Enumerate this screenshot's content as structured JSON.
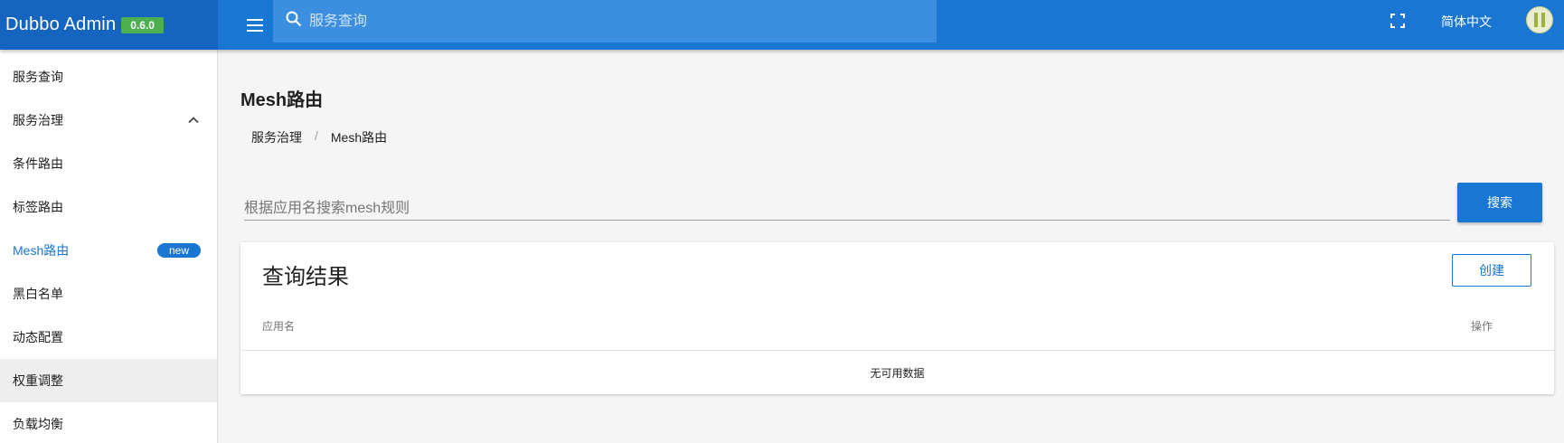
{
  "app": {
    "title": "Dubbo Admin",
    "version": "0.6.0"
  },
  "header": {
    "search_placeholder": "服务查询",
    "language": "简体中文"
  },
  "sidebar": {
    "items": [
      {
        "label": "服务查询"
      },
      {
        "label": "服务治理"
      },
      {
        "label": "条件路由"
      },
      {
        "label": "标签路由"
      },
      {
        "label": "Mesh路由",
        "badge": "new"
      },
      {
        "label": "黑白名单"
      },
      {
        "label": "动态配置"
      },
      {
        "label": "权重调整"
      },
      {
        "label": "负载均衡"
      }
    ]
  },
  "main": {
    "title": "Mesh路由",
    "breadcrumb": [
      "服务治理",
      "Mesh路由"
    ],
    "breadcrumb_sep": "/",
    "search_placeholder": "根据应用名搜索mesh规则",
    "search_button": "搜索",
    "results": {
      "title": "查询结果",
      "create_button": "创建",
      "columns": [
        "应用名",
        "操作"
      ],
      "empty_text": "无可用数据"
    }
  },
  "colors": {
    "primary": "#1976d2",
    "brand_bg": "#1565c0",
    "version_badge": "#4caf50"
  },
  "icons": {
    "menu": "hamburger-icon",
    "search": "search-icon",
    "fullscreen": "fullscreen-icon",
    "collapse": "chevron-up-icon"
  }
}
